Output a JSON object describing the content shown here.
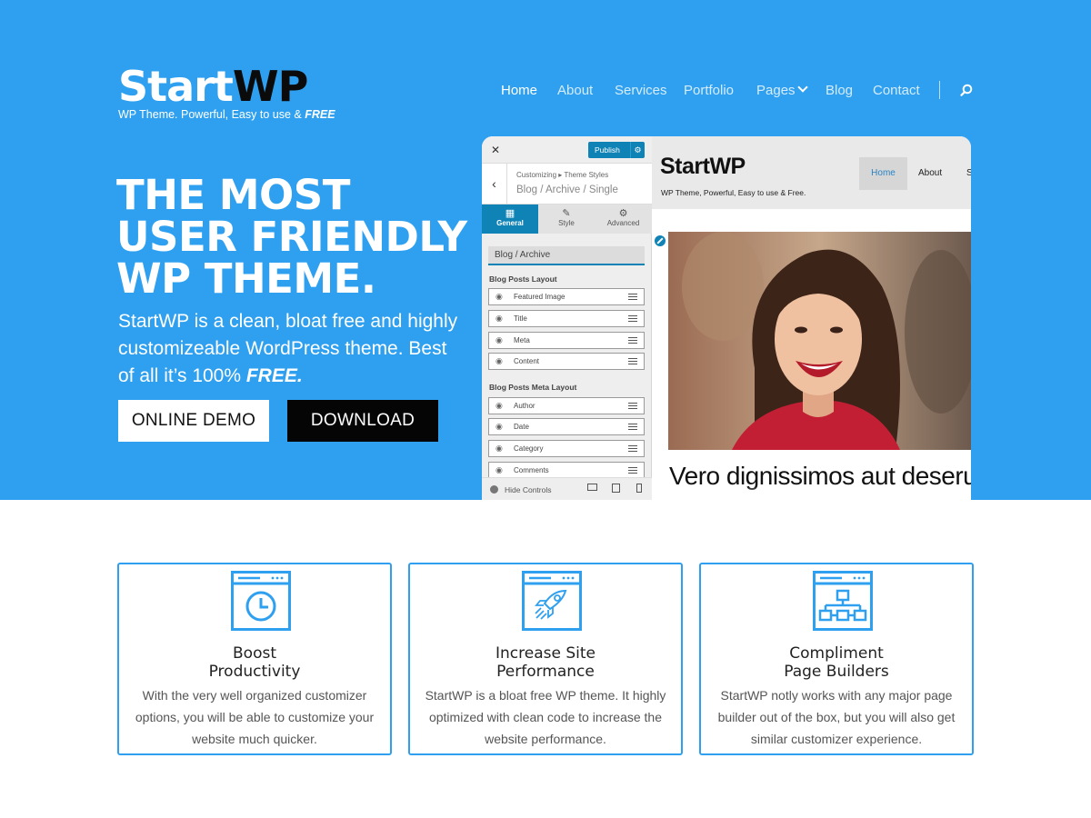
{
  "brand": {
    "logo_part1": "Start",
    "logo_part2": "WP",
    "tagline_prefix": "WP Theme. Powerful, Easy to use & ",
    "tagline_em": "FREE"
  },
  "nav": {
    "items": [
      {
        "label": "Home",
        "active": true
      },
      {
        "label": "About"
      },
      {
        "label": "Services"
      },
      {
        "label": "Portfolio"
      },
      {
        "label": "Pages"
      },
      {
        "label": "Blog"
      },
      {
        "label": "Contact"
      }
    ],
    "search_icon": "search-icon"
  },
  "hero": {
    "headline": [
      "THE MOST",
      "USER FRIENDLY",
      "WP THEME."
    ],
    "intro_text": "StartWP is a clean, bloat free and highly customizeable WordPress theme. Best of all it’s 100% ",
    "intro_em": "FREE.",
    "demo_button": "ONLINE DEMO",
    "download_button": "DOWNLOAD"
  },
  "mockup": {
    "close": "✕",
    "publish": "Publish",
    "breadcrumb_small": "Customizing ▸ Theme Styles",
    "breadcrumb_title": "Blog / Archive / Single",
    "tabs": [
      "General",
      "Style",
      "Advanced"
    ],
    "field_value": "Blog / Archive",
    "section1_title": "Blog Posts Layout",
    "section1_items": [
      "Featured Image",
      "Title",
      "Meta",
      "Content"
    ],
    "section2_title": "Blog Posts Meta Layout",
    "section2_items": [
      "Author",
      "Date",
      "Category",
      "Comments"
    ],
    "hide_controls": "Hide Controls",
    "preview": {
      "logo": "StartWP",
      "tagline": "WP Theme, Powerful, Easy to use & Free.",
      "nav_home": "Home",
      "nav_about": "About",
      "nav_more": "S",
      "post_title": "Vero dignissimos aut deserunt"
    }
  },
  "features": [
    {
      "title_line1": "Boost",
      "title_line2": "Productivity",
      "icon": "clock-icon",
      "desc": "With the very well organized customizer options, you will be able to customize your website much quicker."
    },
    {
      "title_line1": "Increase Site",
      "title_line2": "Performance",
      "icon": "rocket-icon",
      "desc": "StartWP is a bloat free WP theme. It highly optimized with clean code to increase the website performance."
    },
    {
      "title_line1": "Compliment",
      "title_line2": "Page Builders",
      "icon": "sitemap-icon",
      "desc": "StartWP notly works with any major page builder out of the box, but you will also get similar customizer experience."
    }
  ],
  "colors": {
    "accent": "#2fa0ef",
    "customizer_blue": "#0f82b6"
  }
}
